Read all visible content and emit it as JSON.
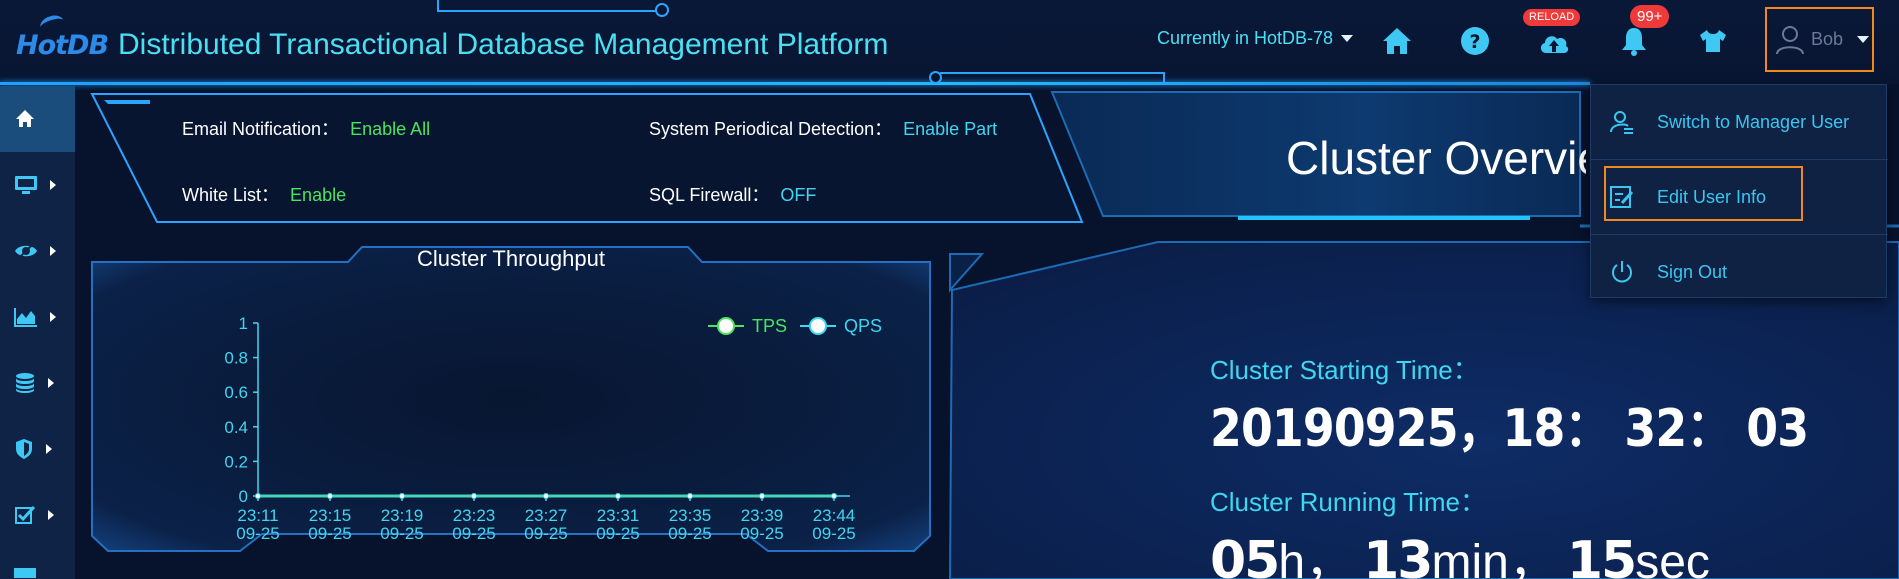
{
  "header": {
    "logo": "HotDB",
    "title": "Distributed Transactional Database Management Platform",
    "current_db": "Currently in HotDB-78",
    "icons": [
      "home-icon",
      "help-icon",
      "cloud-upload-icon",
      "bell-icon",
      "shirt-icon",
      "user-icon"
    ],
    "reload_badge": "RELOAD",
    "notification_badge": "99+",
    "user_name": "Bob"
  },
  "sidebar": {
    "items": [
      {
        "icon": "home-icon",
        "active": true
      },
      {
        "icon": "monitor-icon"
      },
      {
        "icon": "eye-icon"
      },
      {
        "icon": "area-chart-icon"
      },
      {
        "icon": "database-icon"
      },
      {
        "icon": "shield-icon"
      },
      {
        "icon": "checkbox-icon"
      }
    ]
  },
  "status": {
    "email_label": "Email Notification：",
    "email_value": "Enable All",
    "detection_label": "System Periodical Detection：",
    "detection_value": "Enable Part",
    "whitelist_label": "White List：",
    "whitelist_value": "Enable",
    "firewall_label": "SQL Firewall：",
    "firewall_value": "OFF"
  },
  "overview": {
    "title": "Cluster Overvie"
  },
  "throughput": {
    "title": "Cluster Throughput"
  },
  "chart_data": {
    "type": "line",
    "title": "Cluster Throughput",
    "x": [
      "23:11\n09-25",
      "23:15\n09-25",
      "23:19\n09-25",
      "23:23\n09-25",
      "23:27\n09-25",
      "23:31\n09-25",
      "23:35\n09-25",
      "23:39\n09-25",
      "23:44\n09-25"
    ],
    "x_time": [
      "23:11",
      "23:15",
      "23:19",
      "23:23",
      "23:27",
      "23:31",
      "23:35",
      "23:39",
      "23:44"
    ],
    "x_date": "09-25",
    "y_ticks": [
      "0",
      "0.2",
      "0.4",
      "0.6",
      "0.8",
      "1"
    ],
    "ylim": [
      0,
      1
    ],
    "series": [
      {
        "name": "TPS",
        "values": [
          0,
          0,
          0,
          0,
          0,
          0,
          0,
          0,
          0
        ],
        "color": "#4ae55e"
      },
      {
        "name": "QPS",
        "values": [
          0,
          0,
          0,
          0,
          0,
          0,
          0,
          0,
          0
        ],
        "color": "#3fd6f0"
      }
    ],
    "legend": "top-right",
    "grid": false
  },
  "times": {
    "start_label": "Cluster Starting Time：",
    "start_value": "20190925，18： 32： 03",
    "running_label": "Cluster Running Time：",
    "running_hours": "05",
    "running_hours_unit": "h，",
    "running_minutes": "13",
    "running_minutes_unit": "min，",
    "running_seconds": "15",
    "running_seconds_unit": "sec"
  },
  "user_menu": {
    "items": [
      {
        "label": "Switch to Manager User",
        "icon": "user-switch-icon"
      },
      {
        "label": "Edit User Info",
        "icon": "edit-icon"
      },
      {
        "label": "Sign Out",
        "icon": "power-icon"
      }
    ]
  },
  "colors": {
    "background": "#07122c",
    "accent_cyan": "#3fd6f0",
    "accent_green": "#4ae55e",
    "frame_blue": "#2aa4ff",
    "highlight_orange": "#f08a1c",
    "badge_red": "#f03a3a"
  }
}
